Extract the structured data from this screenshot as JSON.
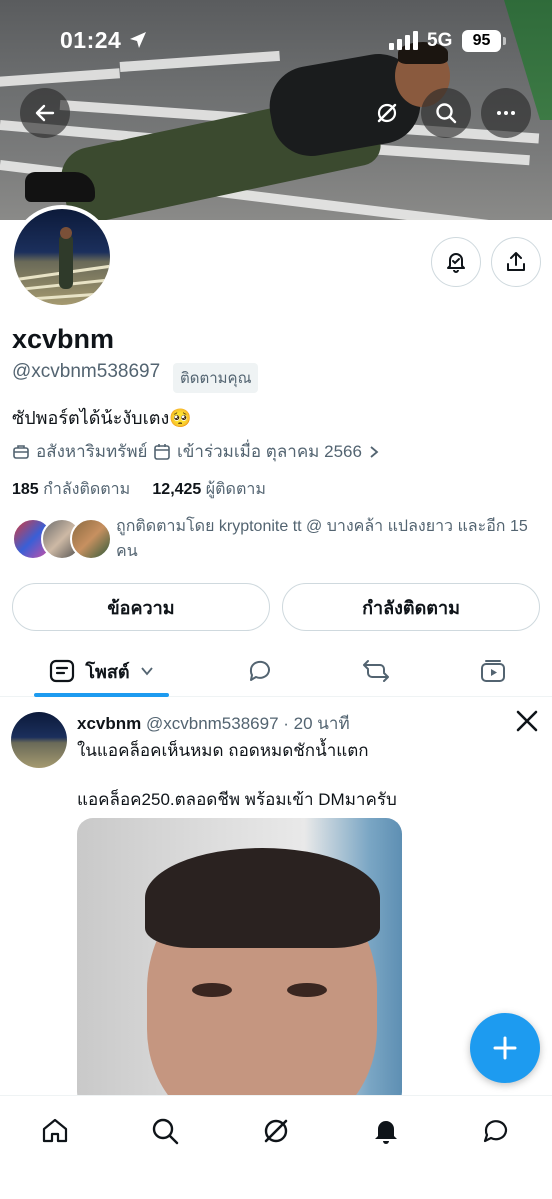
{
  "status_bar": {
    "time": "01:24",
    "network": "5G",
    "battery": "95"
  },
  "profile": {
    "name": "xcvbnm",
    "handle": "@xcvbnm538697",
    "follows_you": "ติดตามคุณ",
    "bio": "ซัปพอร์ตได้น้ะงับเตง🥺",
    "category": "อสังหาริมทรัพย์",
    "joined": "เข้าร่วมเมื่อ ตุลาคม 2566",
    "following_count": "185",
    "following_label": "กำลังติดตาม",
    "followers_count": "12,425",
    "followers_label": "ผู้ติดตาม",
    "followed_by": "ถูกติดตามโดย kryptonite tt @ บางคล้า แปลงยาว และอีก 15 คน"
  },
  "actions": {
    "message": "ข้อความ",
    "following": "กำลังติดตาม"
  },
  "tabs": [
    {
      "label": "โพสต์",
      "icon": "posts-icon",
      "active": true
    },
    {
      "label": "",
      "icon": "reply-icon"
    },
    {
      "label": "",
      "icon": "repost-icon"
    },
    {
      "label": "",
      "icon": "media-icon"
    }
  ],
  "post": {
    "name": "xcvbnm",
    "handle": "@xcvbnm538697",
    "time": "· 20 นาที",
    "line1": "ในแอคล็อคเห็นหมด ถอดหมดชักน้ำแตก",
    "line2": "แอคล็อค250.ตลอดชีพ พร้อมเข้า DMมาครับ"
  },
  "colors": {
    "accent": "#1d9bf0",
    "text": "#0f1419",
    "secondary": "#536471",
    "border": "#cfd9de"
  },
  "bottom_nav": [
    "home-icon",
    "search-icon",
    "grok-icon",
    "notifications-icon",
    "messages-icon"
  ]
}
